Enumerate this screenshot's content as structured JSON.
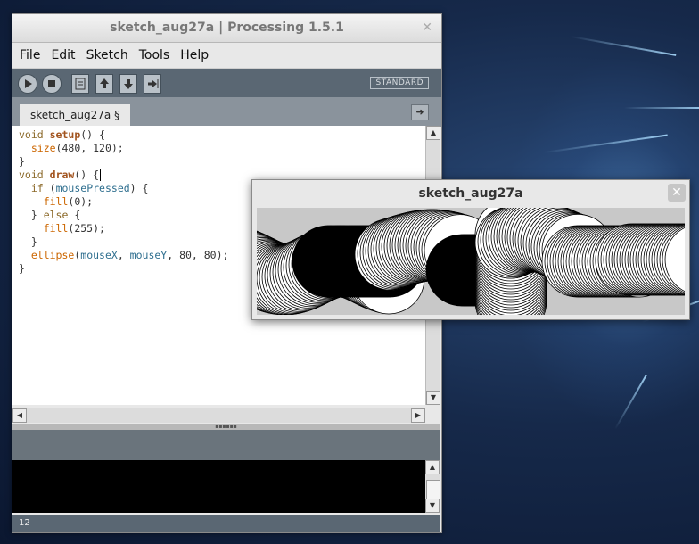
{
  "ide": {
    "title": "sketch_aug27a | Processing 1.5.1",
    "menu": [
      "File",
      "Edit",
      "Sketch",
      "Tools",
      "Help"
    ],
    "mode_label": "STANDARD",
    "tab_label": "sketch_aug27a §",
    "line_number": "12",
    "code_lines": [
      [
        [
          "kw",
          "void "
        ],
        [
          "fn",
          "setup"
        ],
        [
          "",
          "() {"
        ]
      ],
      [
        [
          "",
          "  "
        ],
        [
          "tk",
          "size"
        ],
        [
          "",
          "(480, 120);"
        ]
      ],
      [
        [
          "",
          "}"
        ]
      ],
      [
        [
          "",
          ""
        ]
      ],
      [
        [
          "kw",
          "void "
        ],
        [
          "fn",
          "draw"
        ],
        [
          "",
          "() {"
        ]
      ],
      [
        [
          "",
          "  "
        ],
        [
          "kw",
          "if"
        ],
        [
          "",
          " ("
        ],
        [
          "var",
          "mousePressed"
        ],
        [
          "",
          ") {"
        ]
      ],
      [
        [
          "",
          "    "
        ],
        [
          "tk",
          "fill"
        ],
        [
          "",
          "(0);"
        ]
      ],
      [
        [
          "",
          "  } "
        ],
        [
          "kw",
          "else"
        ],
        [
          "",
          " {"
        ]
      ],
      [
        [
          "",
          "    "
        ],
        [
          "tk",
          "fill"
        ],
        [
          "",
          "(255);"
        ]
      ],
      [
        [
          "",
          "  }"
        ]
      ],
      [
        [
          "",
          "  "
        ],
        [
          "tk",
          "ellipse"
        ],
        [
          "",
          "("
        ],
        [
          "var",
          "mouseX"
        ],
        [
          "",
          ", "
        ],
        [
          "var",
          "mouseY"
        ],
        [
          "",
          ", 80, 80);"
        ]
      ],
      [
        [
          "",
          "}"
        ]
      ]
    ]
  },
  "sketch": {
    "title": "sketch_aug27a"
  },
  "colors": {
    "toolbar": "#5a6773",
    "tabbar": "#8a939c",
    "console": "#000000"
  }
}
